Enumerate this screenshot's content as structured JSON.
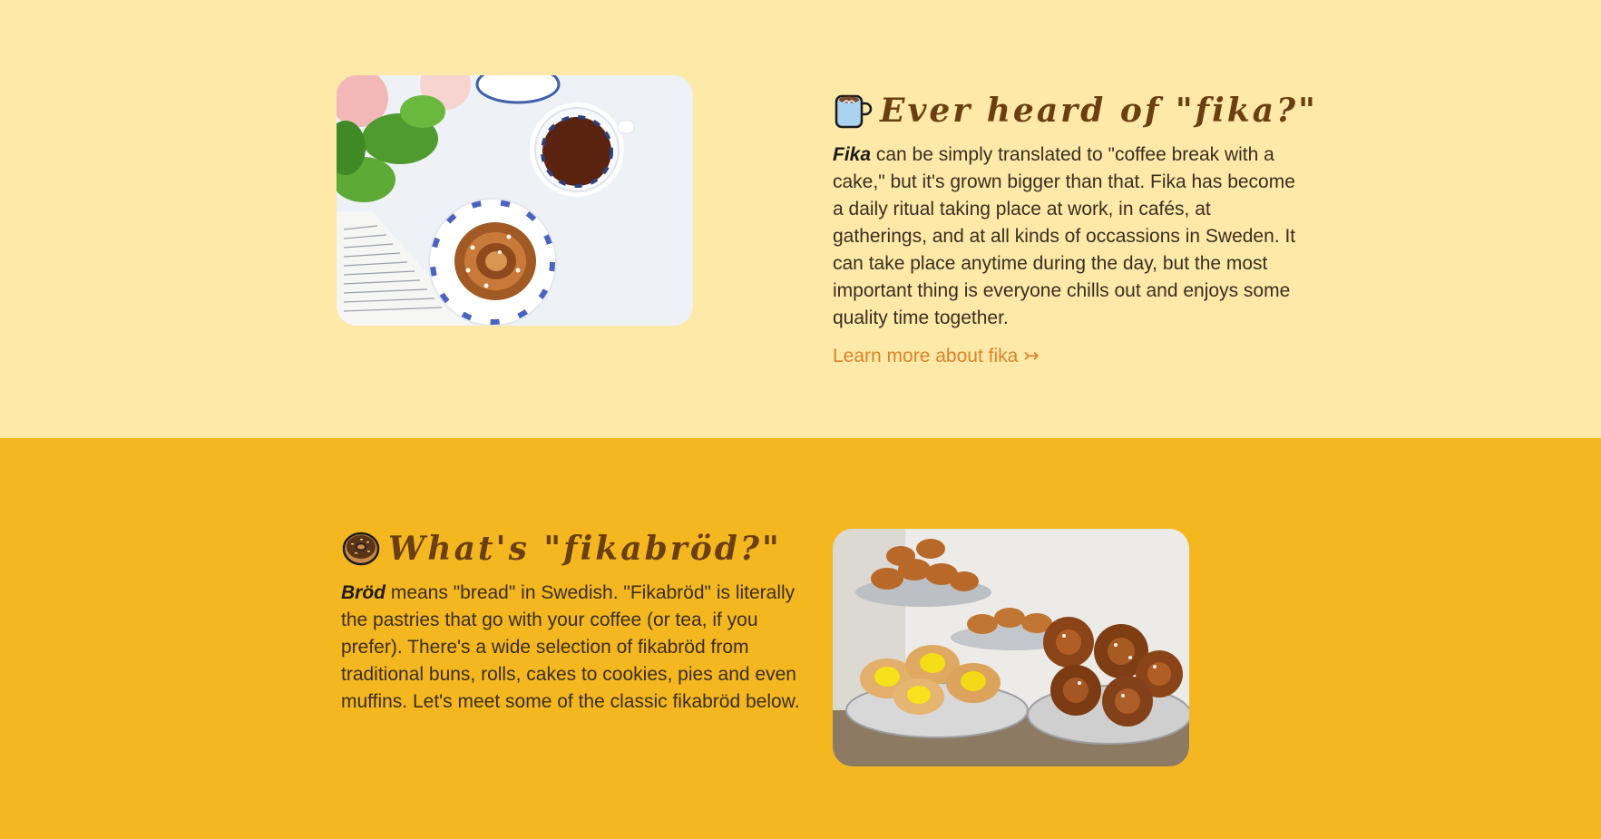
{
  "fika_section": {
    "title": "Ever heard of \"fika?\"",
    "title_icon": "coffee-mug-icon",
    "lead_word": "Fika",
    "body": " can be simply translated to \"coffee break with a cake,\" but it's grown bigger than that. Fika has become a daily ritual taking place at work, in cafés, at gatherings, and at all kinds of occassions in Sweden. It can take place anytime during the day, but the most important thing is everyone chills out and enjoys some quality time together.",
    "link_label": "Learn more about fika ↣",
    "image_subject": "cinnamon-bun-and-tea-photo",
    "background": "#fee9a9"
  },
  "brod_section": {
    "title": "What's \"fikabröd?\"",
    "title_icon": "donut-icon",
    "lead_word": "Bröd",
    "body": " means \"bread\" in Swedish. \"Fikabröd\" is literally the pastries that go with your coffee (or tea, if you prefer). There's a wide selection of fikabröd from traditional buns, rolls, cakes to cookies, pies and even muffins. Let's meet some of the classic fikabröd below.",
    "image_subject": "pastry-display-photo",
    "background": "#f5b71f"
  },
  "colors": {
    "heading": "#6b3f10",
    "body_text": "#3a2e1f",
    "link": "#d9852a"
  }
}
